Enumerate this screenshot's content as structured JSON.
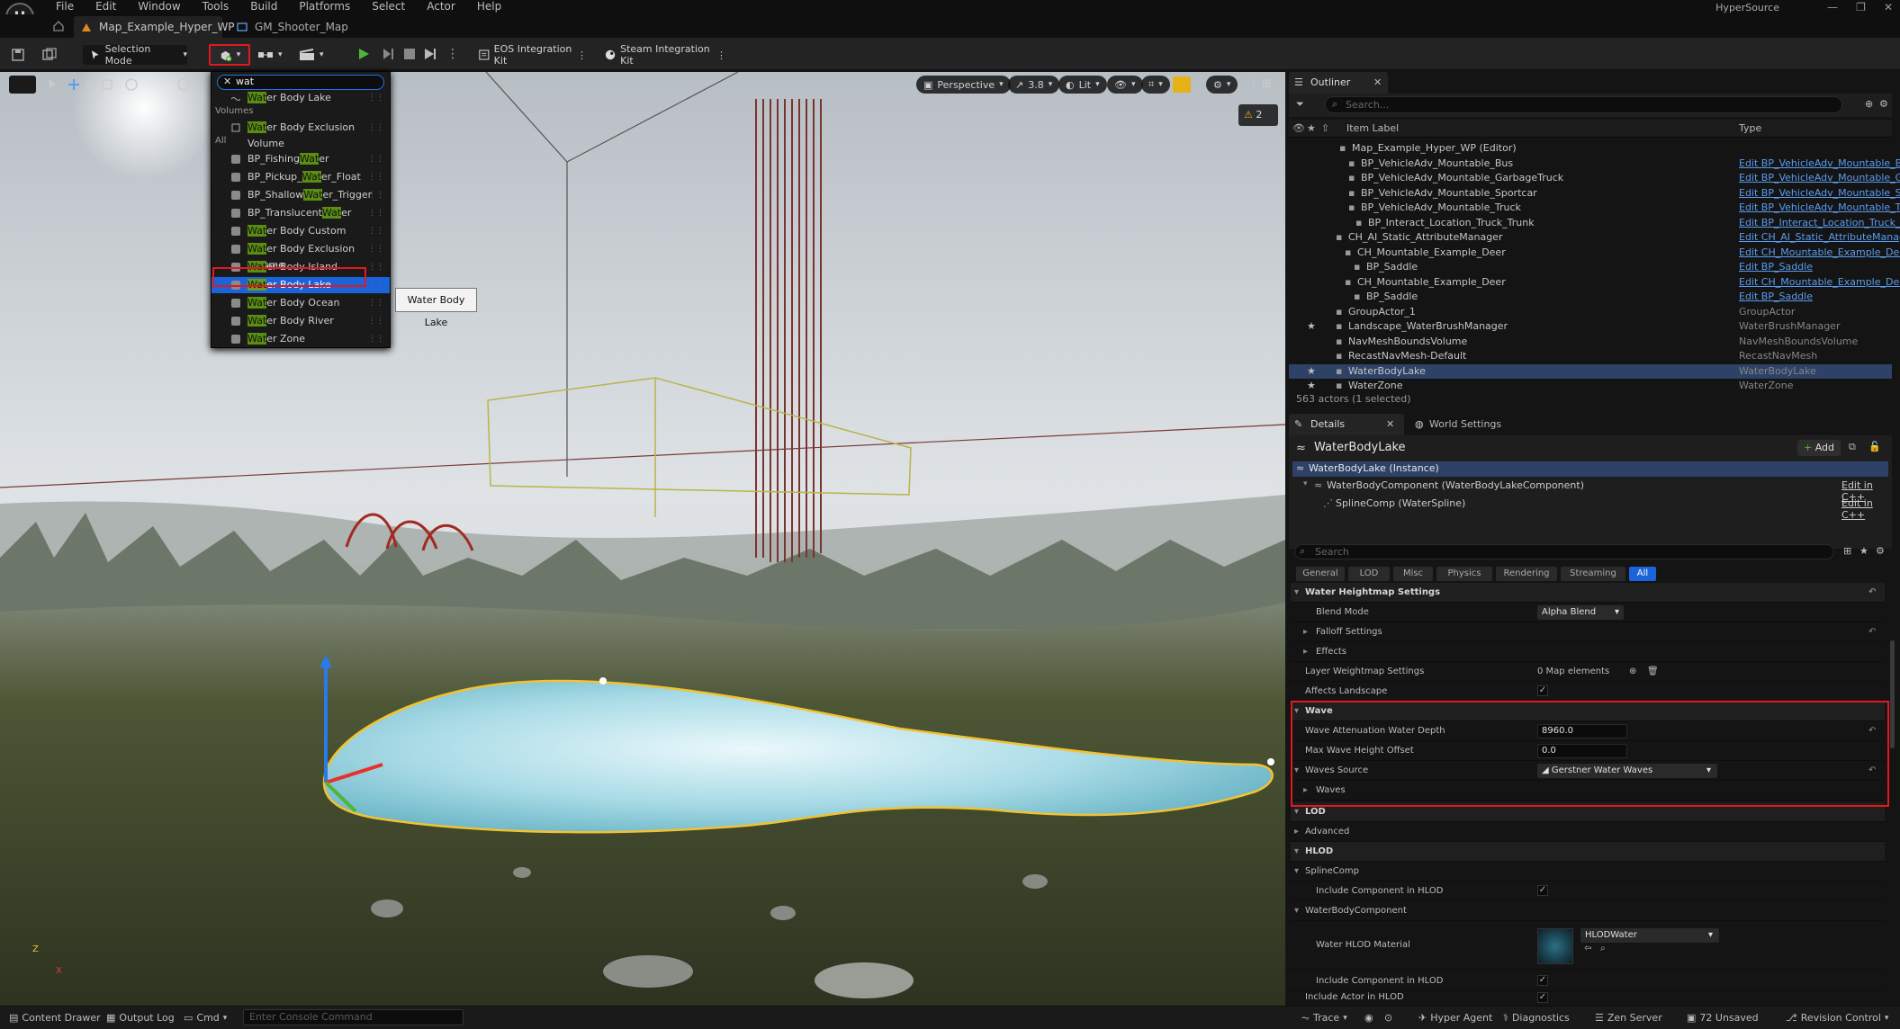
{
  "menu": [
    "File",
    "Edit",
    "Window",
    "Tools",
    "Build",
    "Platforms",
    "Select",
    "Actor",
    "Help"
  ],
  "project_name": "HyperSource",
  "tabs": [
    "Map_Example_Hyper_WP",
    "GM_Shooter_Map"
  ],
  "toolbar": {
    "selection_mode": "Selection Mode",
    "plugin1": "EOS Integration Kit",
    "plugin2": "Steam Integration Kit"
  },
  "viewport": {
    "perspective": "Perspective",
    "fov": "3.8",
    "lit": "Lit",
    "warnings": "2",
    "axis_z": "Z",
    "axis_x": "X"
  },
  "place_dropdown": {
    "search_value": "wat",
    "top_item": "Water Body Lake",
    "section_volumes": "Volumes",
    "volumes_item": "Water Body Exclusion Volume",
    "section_all": "All",
    "all_items": [
      {
        "pre": "BP_Fishing",
        "hl": "Wat",
        "post": "er"
      },
      {
        "pre": "BP_Pickup_",
        "hl": "Wat",
        "post": "er_Float"
      },
      {
        "pre": "BP_Shallow",
        "hl": "Wat",
        "post": "er_Trigger"
      },
      {
        "pre": "BP_Translucent",
        "hl": "Wat",
        "post": "er"
      },
      {
        "pre": "",
        "hl": "Wat",
        "post": "er Body Custom"
      },
      {
        "pre": "",
        "hl": "Wat",
        "post": "er Body Exclusion Volume"
      },
      {
        "pre": "",
        "hl": "Wat",
        "post": "er Body Island"
      },
      {
        "pre": "",
        "hl": "Wat",
        "post": "er Body Lake"
      },
      {
        "pre": "",
        "hl": "Wat",
        "post": "er Body Ocean"
      },
      {
        "pre": "",
        "hl": "Wat",
        "post": "er Body River"
      },
      {
        "pre": "",
        "hl": "Wat",
        "post": "er Zone"
      }
    ],
    "tooltip": "Water Body Lake"
  },
  "outliner": {
    "title": "Outliner",
    "search_placeholder": "Search...",
    "col_label": "Item Label",
    "col_type": "Type",
    "rows": [
      {
        "label": "Map_Example_Hyper_WP (Editor)",
        "type": "",
        "cls": "gray"
      },
      {
        "label": "BP_VehicleAdv_Mountable_Bus",
        "type": "Edit BP_VehicleAdv_Mountable_Bus",
        "cls": "link"
      },
      {
        "label": "BP_VehicleAdv_Mountable_GarbageTruck",
        "type": "Edit BP_VehicleAdv_Mountable_Gar",
        "cls": "link"
      },
      {
        "label": "BP_VehicleAdv_Mountable_Sportcar",
        "type": "Edit BP_VehicleAdv_Mountable_Spo",
        "cls": "link"
      },
      {
        "label": "BP_VehicleAdv_Mountable_Truck",
        "type": "Edit BP_VehicleAdv_Mountable_Tru",
        "cls": "link"
      },
      {
        "label": "BP_Interact_Location_Truck_Trunk",
        "type": "Edit BP_Interact_Location_Truck_T",
        "cls": "link"
      },
      {
        "label": "CH_AI_Static_AttributeManager",
        "type": "Edit CH_AI_Static_AttributeManager",
        "cls": "link"
      },
      {
        "label": "CH_Mountable_Example_Deer",
        "type": "Edit CH_Mountable_Example_Deer",
        "cls": "link"
      },
      {
        "label": "BP_Saddle",
        "type": "Edit BP_Saddle",
        "cls": "link"
      },
      {
        "label": "CH_Mountable_Example_Deer",
        "type": "Edit CH_Mountable_Example_Deer",
        "cls": "link"
      },
      {
        "label": "BP_Saddle",
        "type": "Edit BP_Saddle",
        "cls": "link"
      },
      {
        "label": "GroupActor_1",
        "type": "GroupActor",
        "cls": "gray"
      },
      {
        "label": "Landscape_WaterBrushManager",
        "type": "WaterBrushManager",
        "cls": "gray"
      },
      {
        "label": "NavMeshBoundsVolume",
        "type": "NavMeshBoundsVolume",
        "cls": "gray"
      },
      {
        "label": "RecastNavMesh-Default",
        "type": "RecastNavMesh",
        "cls": "gray"
      },
      {
        "label": "WaterBodyLake",
        "type": "WaterBodyLake",
        "cls": "gray"
      },
      {
        "label": "WaterZone",
        "type": "WaterZone",
        "cls": "gray"
      }
    ],
    "status": "563 actors (1 selected)"
  },
  "details": {
    "tab1": "Details",
    "tab2": "World Settings",
    "actor_name": "WaterBodyLake",
    "add_label": "Add",
    "instance": "WaterBodyLake (Instance)",
    "component": "WaterBodyComponent (WaterBodyLakeComponent)",
    "edit_cpp1": "Edit in C++",
    "spline": "SplineComp (WaterSpline)",
    "edit_cpp2": "Edit in C++",
    "search_placeholder": "Search",
    "categories": [
      "General",
      "LOD",
      "Misc",
      "Physics",
      "Rendering",
      "Streaming",
      "All"
    ],
    "props": {
      "heightmap": "Water Heightmap Settings",
      "blend_mode": "Blend Mode",
      "blend_mode_value": "Alpha Blend",
      "falloff": "Falloff Settings",
      "effects": "Effects",
      "layer_weightmap": "Layer Weightmap Settings",
      "map_elements": "0 Map elements",
      "affects_landscape": "Affects Landscape",
      "wave": "Wave",
      "wave_atten": "Wave Attenuation Water Depth",
      "wave_atten_value": "8960.0",
      "max_wave": "Max Wave Height Offset",
      "max_wave_value": "0.0",
      "waves_source": "Waves Source",
      "waves_source_value": "Gerstner Water Waves",
      "waves": "Waves",
      "lod": "LOD",
      "advanced": "Advanced",
      "hlod": "HLOD",
      "splinecomp": "SplineComp",
      "include_hlod1": "Include Component in HLOD",
      "waterbodycomponent": "WaterBodyComponent",
      "water_hlod_material": "Water HLOD Material",
      "hlod_material_value": "HLODWater",
      "include_hlod2": "Include Component in HLOD",
      "include_actor": "Include Actor in HLOD"
    }
  },
  "statusbar": {
    "content_drawer": "Content Drawer",
    "output_log": "Output Log",
    "cmd": "Cmd",
    "console_placeholder": "Enter Console Command",
    "trace": "Trace",
    "hyper_agent": "Hyper Agent",
    "diagnostics": "Diagnostics",
    "zen_server": "Zen Server",
    "unsaved": "72 Unsaved",
    "revision": "Revision Control"
  },
  "colors": {
    "accent": "#1b63d8",
    "highlight": "#e0191e",
    "search_match": "#5a8e12",
    "link": "#5a9cf0"
  }
}
